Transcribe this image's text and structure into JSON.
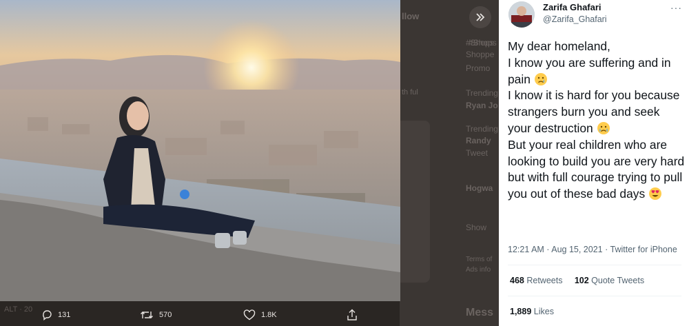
{
  "background": {
    "follow_label": "llow",
    "texts": [
      "#Shops",
      "Shoppe",
      "Promo",
      "Trending",
      "Ryan Jo",
      "Trending",
      "Randy",
      "Tweet",
      "Hogwa",
      "Show",
      "Terms of",
      "Ads info"
    ],
    "messages_label": "Mess",
    "media_caption": "ALT · 20",
    "reply_bubble": "th ful"
  },
  "actions": {
    "reply_count": "131",
    "retweet_count": "570",
    "like_count": "1.8K"
  },
  "tweet": {
    "author_name": "Zarifa Ghafari",
    "author_handle": "@Zarifa_Ghafari",
    "more": "···",
    "lines": {
      "l1": "My dear homeland,",
      "l2": "I know you are suffering and in pain",
      "l3": "I know it is hard for you because strangers burn you and seek your destruction",
      "l4": "But your real children who are looking to build you are very hard but with full courage trying to pull you out of these bad days"
    },
    "time": "12:21 AM · Aug 15, 2021 ·",
    "source": "Twitter for iPhone",
    "retweets_count": "468",
    "retweets_label": "Retweets",
    "quotes_count": "102",
    "quotes_label": "Quote Tweets",
    "likes_count": "1,889",
    "likes_label": "Likes"
  },
  "icons": {
    "reply": "reply-icon",
    "retweet": "retweet-icon",
    "like": "heart-icon",
    "share": "share-icon",
    "expand": "double-chevron-right-icon",
    "more": "more-icon"
  },
  "colors": {
    "overlay": "#2a2623",
    "panel": "#ffffff",
    "text": "#0f1419",
    "secondary": "#536471"
  }
}
